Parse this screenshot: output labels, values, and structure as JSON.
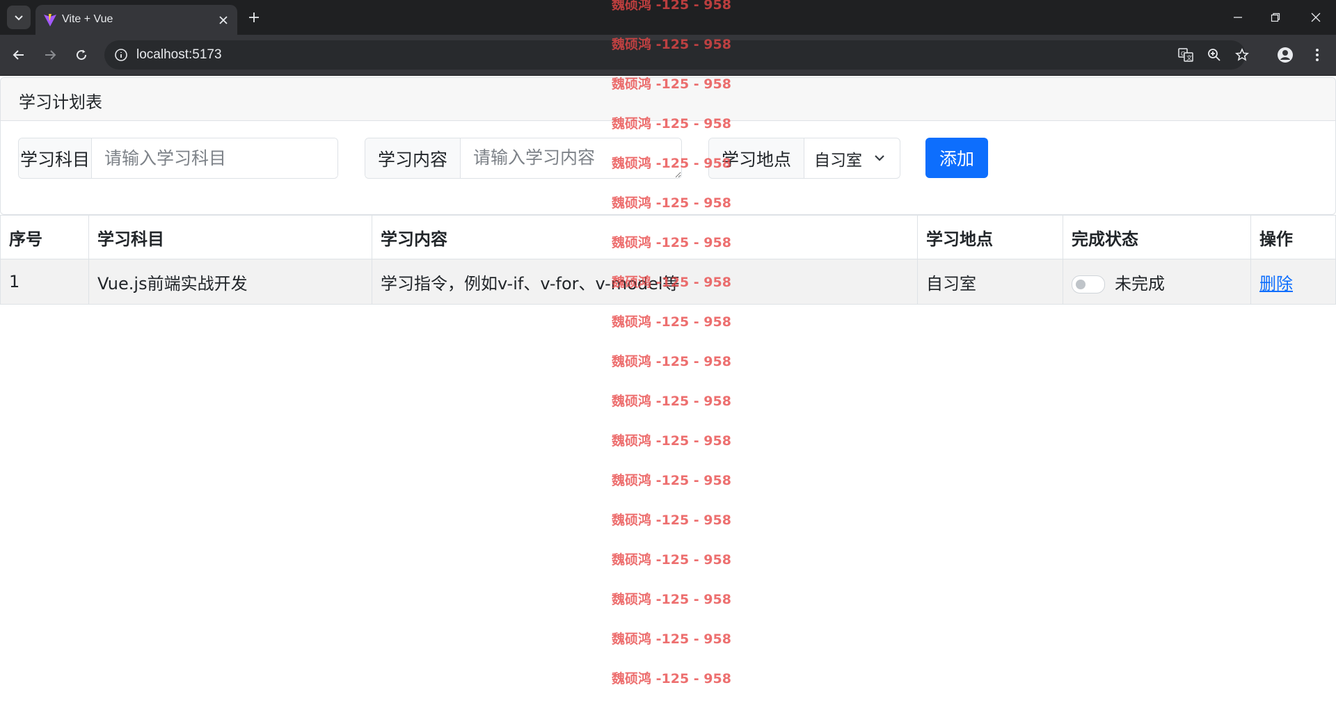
{
  "browser": {
    "tab_title": "Vite + Vue",
    "url": "localhost:5173"
  },
  "card": {
    "title": "学习计划表"
  },
  "form": {
    "subject_label": "学习科目",
    "subject_placeholder": "请输入学习科目",
    "content_label": "学习内容",
    "content_placeholder": "请输入学习内容",
    "location_label": "学习地点",
    "location_selected": "自习室",
    "add_label": "添加"
  },
  "table": {
    "headers": [
      "序号",
      "学习科目",
      "学习内容",
      "学习地点",
      "完成状态",
      "操作"
    ],
    "rows": [
      {
        "index": "1",
        "subject": "Vue.js前端实战开发",
        "content": "学习指令，例如v-if、v-for、v-model等",
        "location": "自习室",
        "status": "未完成",
        "action": "删除"
      }
    ]
  },
  "watermark": {
    "text": "魏硕鸿 -125 - 958",
    "lines": [
      "魏硕鸿 -125 - 958",
      "魏硕鸿 -125 - 958",
      "魏硕鸿 -125 - 958",
      "魏硕鸿 -125 - 958",
      "魏硕鸿 -125 - 958",
      "魏硕鸿 -125 - 958",
      "魏硕鸿 -125 - 958",
      "魏硕鸿 -125 - 958",
      "魏硕鸿 -125 - 958",
      "魏硕鸿 -125 - 958",
      "魏硕鸿 -125 - 958",
      "魏硕鸿 -125 - 958",
      "魏硕鸿 -125 - 958",
      "魏硕鸿 -125 - 958",
      "魏硕鸿 -125 - 958",
      "魏硕鸿 -125 - 958",
      "魏硕鸿 -125 - 958",
      "魏硕鸿 -125 - 958"
    ]
  },
  "colors": {
    "primary": "#0d6efd",
    "watermark": "#e84646",
    "tab_bar": "#1f2022",
    "toolbar": "#35363a"
  }
}
